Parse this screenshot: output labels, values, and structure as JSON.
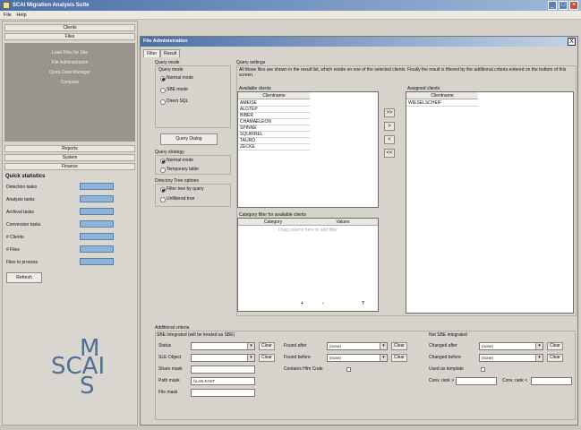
{
  "app": {
    "title": "SCAI Migration Analysis Suite",
    "menu": [
      "File",
      "Help"
    ]
  },
  "nav": {
    "top_buttons": [
      "Clients",
      "Files"
    ],
    "panel_links": [
      "Load Files for Site",
      "File Administration",
      "Quick Data Manager",
      "Compare"
    ],
    "bottom_buttons": [
      "Reports",
      "System",
      "Finance"
    ],
    "stats_title": "Quick statistics",
    "stats": [
      {
        "label": "Detection tasks"
      },
      {
        "label": "Analysis tasks"
      },
      {
        "label": "Archival tasks"
      },
      {
        "label": "Conversion tasks"
      },
      {
        "label": "# Clients"
      },
      {
        "label": "# Files"
      },
      {
        "label": "Files to process"
      }
    ],
    "refresh_label": "Refresh",
    "logo": [
      "M",
      "SCAI",
      "S"
    ]
  },
  "main": {
    "title": "File Administration",
    "close_label": "X",
    "tabs": [
      "Filter",
      "Result"
    ],
    "query_mode": {
      "title": "Query mode",
      "sub": "Query mode",
      "options": [
        "Normal mode",
        "SBE mode",
        "Direct SQL"
      ],
      "query_dialog_label": "Query Dialog",
      "strategy_title": "Query strategy",
      "strategy_options": [
        "Normal mode",
        "Temporary table"
      ],
      "tree_title": "Directory Tree options",
      "tree_options": [
        "Filter tree by query",
        "Unfiltered tree"
      ]
    },
    "settings": {
      "title": "Query settings",
      "description": "All those files are shown in the result list, which reside on one of the selected clients. Finally the result is filtered by the additional criteria entered on the bottom of this screen.",
      "available_title": "Available clients",
      "available_header": "Clientname",
      "available_clients": [
        "AMEISE",
        "ALGTEP",
        "BIBER",
        "CHAMAELEON",
        "SPINNE",
        "SQUIRREL",
        "TAURO",
        "ZECKE"
      ],
      "assigned_title": "Assigned clients",
      "assigned_header": "Clientname",
      "assigned_clients": [
        "WIESELSCHEIF"
      ],
      "arrow_buttons": [
        ">>",
        ">",
        "<",
        "<<"
      ],
      "category_title": "Category filter for available clients",
      "category_headers": [
        "Category",
        "Values"
      ],
      "category_placeholder": "Drag column here to add filter",
      "nav_symbols": [
        "+",
        "-",
        "?"
      ]
    },
    "criteria": {
      "title": "Additional criteria",
      "sbe_title": "SBE integrated (will be treated as SBE)",
      "status_label": "Status",
      "sle_label": "SLE Object",
      "share_label": "Share mask",
      "path_label": "Path mask",
      "path_value": "\\\\LAN-FAST",
      "file_label": "File mask",
      "clear": "Clear",
      "found_after": "Found after",
      "found_before": "Found before",
      "found_after_value": "(none)",
      "found_before_value": "(none)",
      "contains_label": "Contains Hfm Code",
      "not_sbe_title": "Not SBE integrated",
      "changed_after": "Changed after",
      "changed_before": "Changed before",
      "changed_after_value": "(none)",
      "changed_before_value": "(none)",
      "template_label": "Used as template",
      "conv_from": "Conv. rank >",
      "conv_to": "Conv. rank <"
    }
  },
  "colors": {
    "titlebar": "#4a6fa5",
    "stats_bar": "#8fb3d9",
    "logo": "#4f6f98"
  }
}
